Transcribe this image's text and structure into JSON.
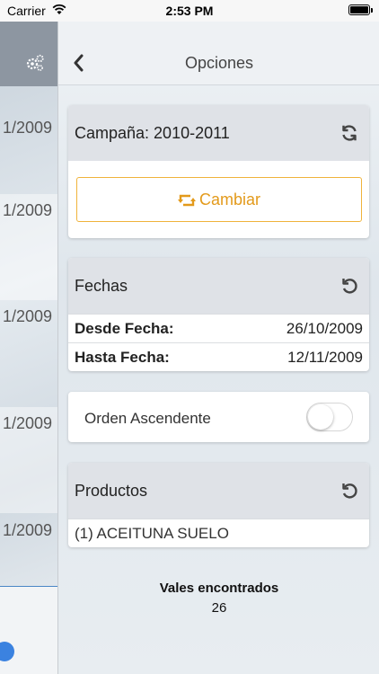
{
  "status_bar": {
    "carrier": "Carrier",
    "time": "2:53 PM"
  },
  "left_panel": {
    "rows": [
      "1/2009",
      "1/2009",
      "1/2009",
      "1/2009",
      "1/2009"
    ]
  },
  "nav": {
    "title": "Opciones"
  },
  "campaign": {
    "label": "Campaña: 2010-2011",
    "change_label": "Cambiar"
  },
  "dates": {
    "header": "Fechas",
    "from_label": "Desde Fecha:",
    "from_value": "26/10/2009",
    "to_label": "Hasta Fecha:",
    "to_value": "12/11/2009"
  },
  "order": {
    "label": "Orden Ascendente",
    "enabled": false
  },
  "products": {
    "header": "Productos",
    "items": [
      "(1) ACEITUNA SUELO"
    ]
  },
  "results": {
    "label": "Vales encontrados",
    "count": "26"
  },
  "colors": {
    "accent": "#f0b33b",
    "accent_text": "#e39a1b",
    "link_blue": "#4a86c5"
  },
  "icons": {
    "wifi": "wifi-icon",
    "battery": "battery-icon",
    "gear": "gears-icon",
    "back": "chevron-left-icon",
    "refresh": "sync-icon",
    "retweet": "retweet-icon",
    "undo": "undo-icon"
  }
}
